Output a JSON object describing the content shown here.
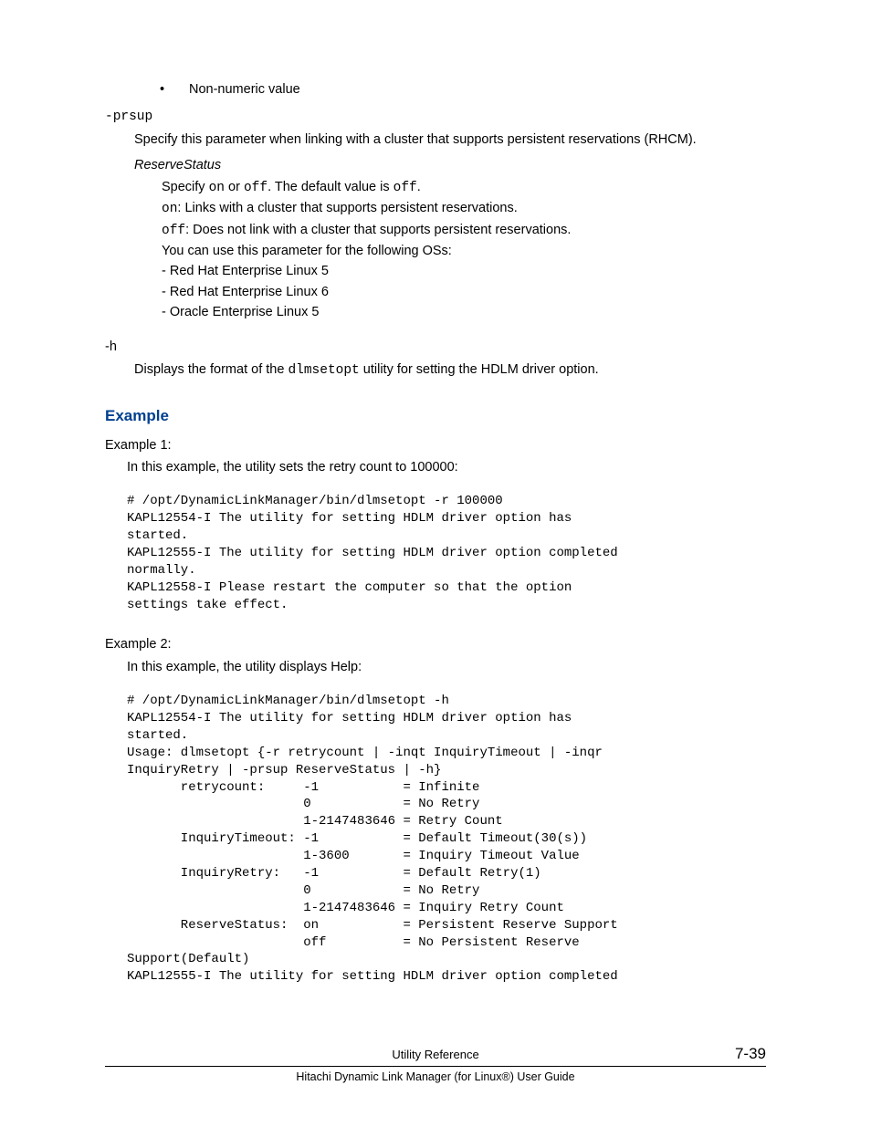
{
  "bullet1": "Non-numeric value",
  "param_prsup": {
    "name": "-prsup",
    "desc": "Specify this parameter when linking with a cluster that supports persistent reservations (RHCM).",
    "subhead": "ReserveStatus",
    "spec_prefix": "Specify ",
    "spec_on": "on",
    "spec_or": " or ",
    "spec_off": "off",
    "spec_mid": ". The default value is ",
    "spec_off2": "off",
    "spec_end": ".",
    "on_code": "on",
    "on_text": ": Links with a cluster that supports persistent reservations.",
    "off_code": "off",
    "off_text": ": Does not link with a cluster that supports persistent reservations.",
    "os_intro": "You can use this parameter for the following OSs:",
    "os1": "- Red Hat Enterprise Linux 5",
    "os2": "- Red Hat Enterprise Linux 6",
    "os3": "- Oracle Enterprise Linux 5"
  },
  "param_h": {
    "name": "-h",
    "desc_a": "Displays the format of the ",
    "desc_code": "dlmsetopt",
    "desc_b": " utility for setting the HDLM driver option."
  },
  "example_heading": "Example",
  "ex1": {
    "label": "Example 1:",
    "desc": "In this example, the utility sets the retry count to 100000:",
    "code": "# /opt/DynamicLinkManager/bin/dlmsetopt -r 100000\nKAPL12554-I The utility for setting HDLM driver option has \nstarted.\nKAPL12555-I The utility for setting HDLM driver option completed \nnormally.\nKAPL12558-I Please restart the computer so that the option \nsettings take effect."
  },
  "ex2": {
    "label": "Example 2:",
    "desc": "In this example, the utility displays Help:",
    "code": "# /opt/DynamicLinkManager/bin/dlmsetopt -h\nKAPL12554-I The utility for setting HDLM driver option has \nstarted.\nUsage: dlmsetopt {-r retrycount | -inqt InquiryTimeout | -inqr \nInquiryRetry | -prsup ReserveStatus | -h}\n       retrycount:     -1           = Infinite\n                       0            = No Retry\n                       1-2147483646 = Retry Count\n       InquiryTimeout: -1           = Default Timeout(30(s))\n                       1-3600       = Inquiry Timeout Value\n       InquiryRetry:   -1           = Default Retry(1)\n                       0            = No Retry\n                       1-2147483646 = Inquiry Retry Count\n       ReserveStatus:  on           = Persistent Reserve Support\n                       off          = No Persistent Reserve \nSupport(Default)\nKAPL12555-I The utility for setting HDLM driver option completed "
  },
  "footer": {
    "title": "Utility Reference",
    "page": "7-39",
    "sub": "Hitachi Dynamic Link Manager (for Linux®) User Guide"
  }
}
